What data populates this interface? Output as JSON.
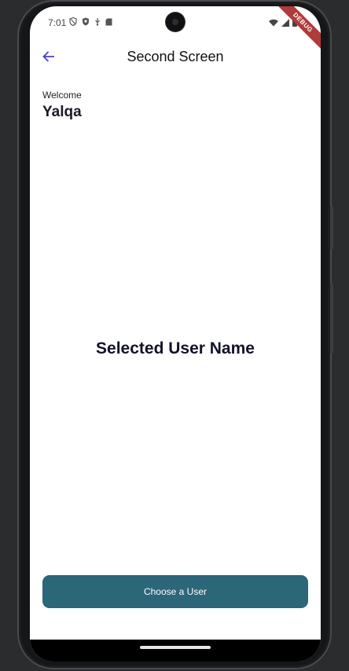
{
  "status_bar": {
    "time": "7:01",
    "left_icons": [
      "shield-icon",
      "shield-check-icon",
      "usb-icon",
      "sd-card-icon"
    ],
    "right_icons": [
      "wifi-icon",
      "signal-icon",
      "battery-icon"
    ],
    "debug_banner": "DEBUG"
  },
  "app_bar": {
    "title": "Second Screen",
    "back_icon": "arrow-back-icon",
    "accent_color": "#4a3fd6"
  },
  "welcome": {
    "label": "Welcome",
    "name": "Yalqa"
  },
  "selected_user": {
    "text": "Selected User Name"
  },
  "choose_button": {
    "label": "Choose a User",
    "color": "#2b6679"
  }
}
